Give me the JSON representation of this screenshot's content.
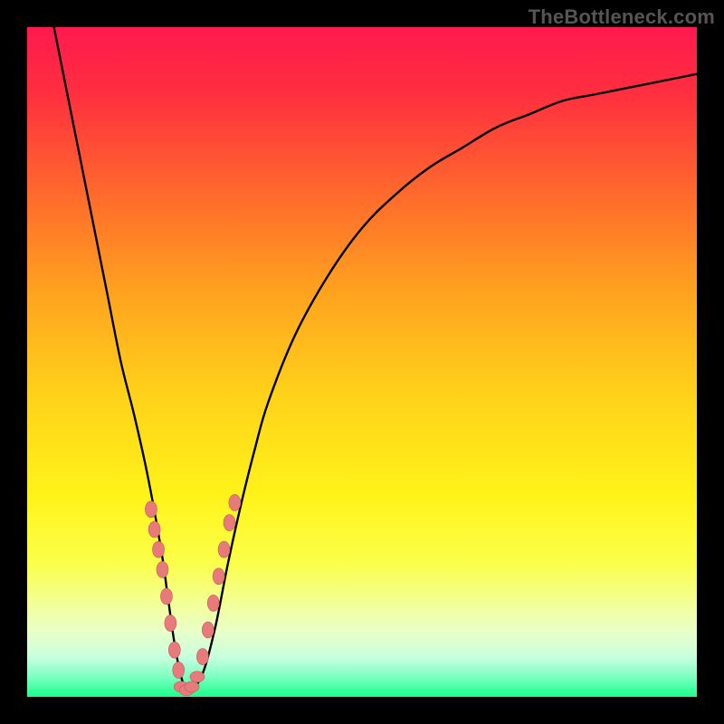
{
  "watermark": {
    "text": "TheBottleneck.com"
  },
  "colors": {
    "frame": "#000000",
    "gradient_stops": [
      {
        "offset": 0.0,
        "color": "#ff1a4e"
      },
      {
        "offset": 0.1,
        "color": "#ff2f3f"
      },
      {
        "offset": 0.25,
        "color": "#ff6a2c"
      },
      {
        "offset": 0.4,
        "color": "#ffa41f"
      },
      {
        "offset": 0.55,
        "color": "#ffd21a"
      },
      {
        "offset": 0.7,
        "color": "#fff31a"
      },
      {
        "offset": 0.8,
        "color": "#fbff4a"
      },
      {
        "offset": 0.86,
        "color": "#f3ff96"
      },
      {
        "offset": 0.9,
        "color": "#e9ffc6"
      },
      {
        "offset": 0.94,
        "color": "#c9ffde"
      },
      {
        "offset": 0.97,
        "color": "#7dffc2"
      },
      {
        "offset": 1.0,
        "color": "#1aff8a"
      }
    ],
    "curve": "#000000",
    "marker_fill": "#e77b7b",
    "marker_stroke": "#c85a5a"
  },
  "chart_data": {
    "type": "line",
    "title": "",
    "xlabel": "",
    "ylabel": "",
    "xlim": [
      0,
      100
    ],
    "ylim": [
      0,
      100
    ],
    "grid": false,
    "series": [
      {
        "name": "bottleneck-curve",
        "x": [
          4,
          6,
          8,
          10,
          12,
          14,
          16,
          18,
          20,
          21,
          22,
          23,
          24,
          26,
          28,
          30,
          32,
          34,
          36,
          40,
          45,
          50,
          55,
          60,
          65,
          70,
          75,
          80,
          85,
          90,
          95,
          100
        ],
        "y": [
          100,
          90,
          80,
          70,
          60,
          50,
          42,
          33,
          22,
          15,
          8,
          3,
          1,
          3,
          10,
          20,
          29,
          37,
          44,
          54,
          63,
          70,
          75,
          79,
          82,
          85,
          87,
          89,
          90,
          91,
          92,
          93
        ]
      }
    ],
    "markers": [
      {
        "name": "left-band",
        "x": [
          18.5,
          19.0,
          19.6,
          20.2,
          20.8,
          21.4,
          22.0,
          22.6
        ],
        "y": [
          28,
          25,
          22,
          19,
          15,
          11,
          7,
          4
        ]
      },
      {
        "name": "valley",
        "x": [
          23.0,
          23.8,
          24.6,
          25.4
        ],
        "y": [
          1.5,
          1.0,
          1.5,
          3.0
        ]
      },
      {
        "name": "right-band",
        "x": [
          26.2,
          27.0,
          27.8,
          28.6,
          29.4,
          30.2,
          31.0
        ],
        "y": [
          6,
          10,
          14,
          18,
          22,
          26,
          29
        ]
      }
    ],
    "annotations": []
  }
}
